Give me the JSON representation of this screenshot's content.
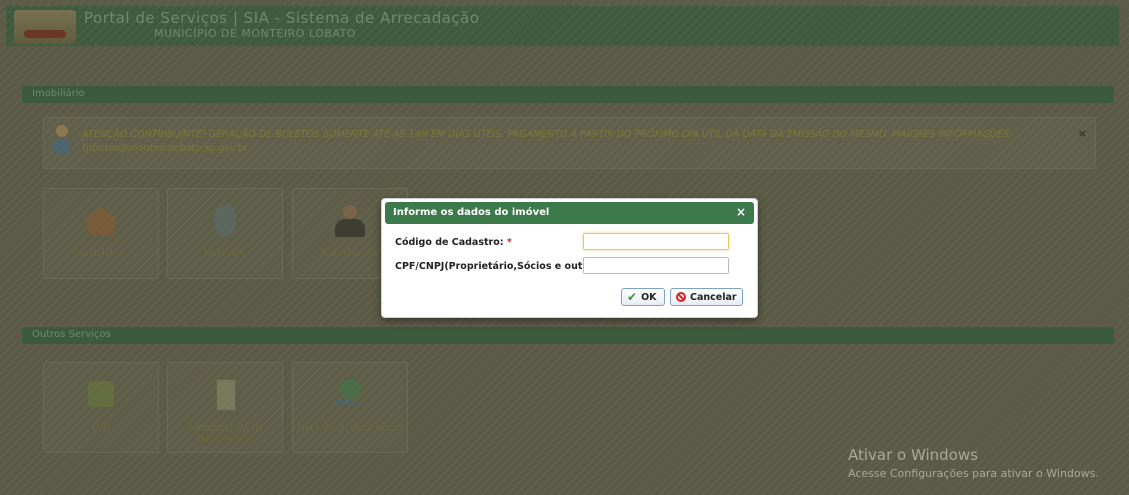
{
  "header": {
    "title": "Portal de Serviços | SIA - Sistema de Arrecadação",
    "subtitle": "MUNICÍPIO DE MONTEIRO LOBATO"
  },
  "sections": {
    "first_title": "Imobiliário",
    "second_title": "Outros Serviços"
  },
  "notice": {
    "text": "ATENÇÃO CONTRIBUINTE! GERAÇÃO DE BOLETOS SOMENTE ATÉ AS 14H EM DIAS ÚTEIS, PAGAMENTO A PARTIR DO PRÓXIMO DIA ÚTIL DA DATA DA EMISSÃO DO MESMO. MAIORES INFORMAÇÕES: tributos@monteirolobato.sp.gov.br",
    "close": "×"
  },
  "tiles_top": [
    {
      "label": "Imobiliário",
      "icon": "house-icon"
    },
    {
      "label": "Mobiliário",
      "icon": "shield-icon"
    },
    {
      "label": "Contribuinte",
      "icon": "person-icon"
    }
  ],
  "tiles_bottom": [
    {
      "label": "ITBI",
      "icon": "iss-icon"
    },
    {
      "label": "Autenticidade de Documentos",
      "icon": "document-icon"
    },
    {
      "label": "Nota Fiscal de Serviços",
      "icon": "nfse-icon"
    }
  ],
  "modal": {
    "title": "Informe os dados do imóvel",
    "close": "×",
    "field1_label": "Código de Cadastro:",
    "field1_value": "",
    "field2_label": "CPF/CNPJ(Proprietário,Sócios e outros):",
    "field2_value": "",
    "required_mark": "*",
    "ok_label": "OK",
    "cancel_label": "Cancelar"
  },
  "watermark": {
    "title": "Ativar o Windows",
    "subtitle": "Acesse Configurações para ativar o Windows."
  },
  "colors": {
    "accent": "#3c7a4c",
    "overlay": "#5b5a45"
  }
}
